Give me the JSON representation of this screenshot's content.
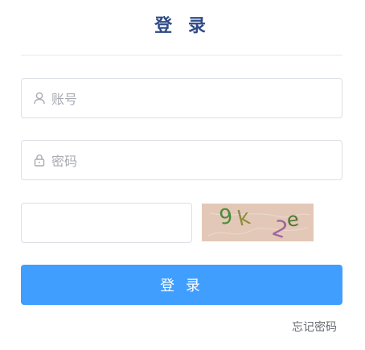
{
  "form": {
    "title": "登 录",
    "account_placeholder": "账号",
    "password_placeholder": "密码",
    "captcha_text": "9k 2e",
    "login_label": "登 录",
    "forgot_password": "忘记密码"
  },
  "icons": {
    "account": "user-icon",
    "password": "lock-icon"
  },
  "colors": {
    "title": "#2f4a86",
    "primary_button": "#409eff",
    "captcha_background": "#e3c8b7",
    "placeholder": "#a8abb2",
    "border": "#dcdfe6"
  }
}
